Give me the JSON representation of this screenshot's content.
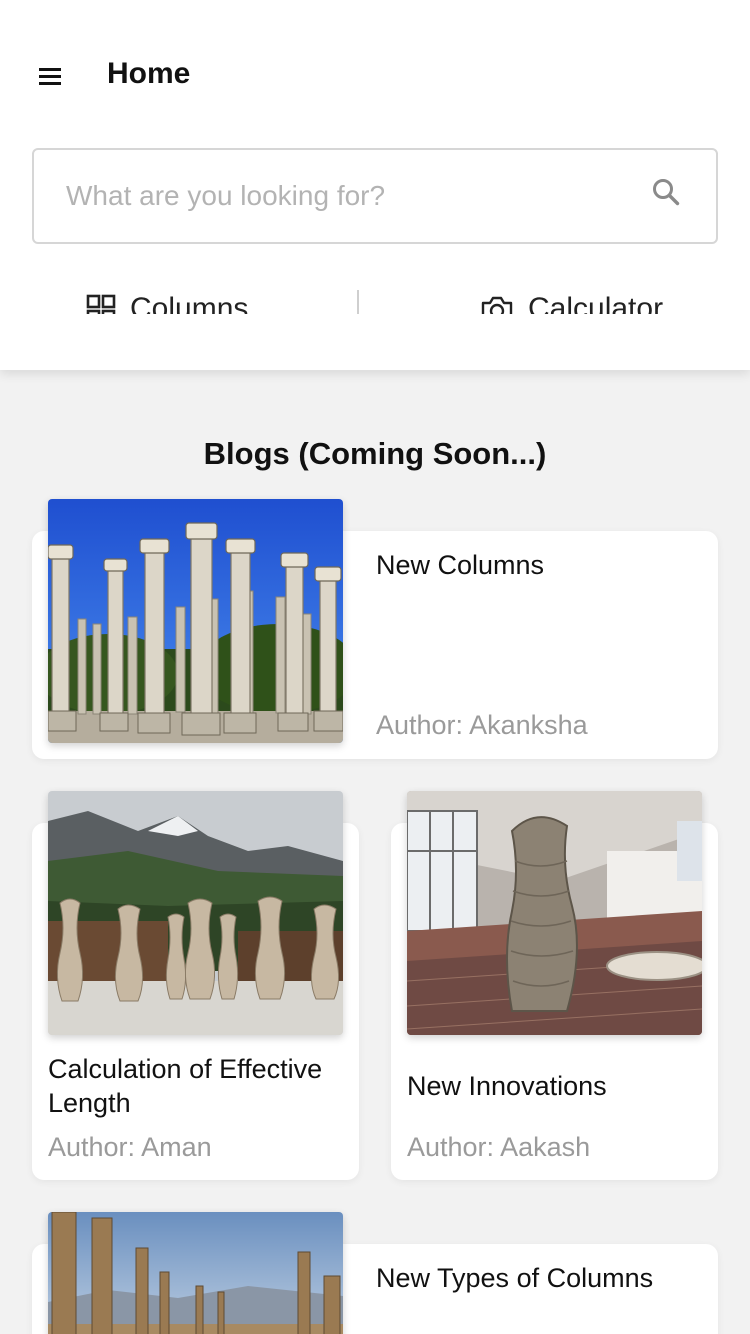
{
  "header": {
    "menu_icon": "hamburger-menu-icon",
    "title": "Home"
  },
  "search": {
    "placeholder": "What are you looking for?",
    "value": "",
    "icon": "search-icon"
  },
  "quick_nav": [
    {
      "label": "Columns",
      "icon": "grid-icon"
    },
    {
      "label": "Calculator",
      "icon": "camera-icon"
    }
  ],
  "blogs": {
    "title": "Blogs (Coming Soon...)",
    "items": [
      {
        "title": "New Columns",
        "author": "Author: Akanksha",
        "image": "classical-columns-photo"
      },
      {
        "title": "Calculation of Effective Length",
        "author": "Author: Aman",
        "image": "3d-printed-columns-mountains-photo"
      },
      {
        "title": "New Innovations",
        "author": "Author: Aakash",
        "image": "printed-column-hall-photo"
      },
      {
        "title": "New Types of Columns",
        "author": "",
        "image": "ancient-ruins-columns-photo"
      }
    ]
  },
  "colors": {
    "background": "#f2f2f2",
    "card": "#ffffff",
    "muted_text": "#9a9a9a",
    "border": "#d6d6d6"
  }
}
